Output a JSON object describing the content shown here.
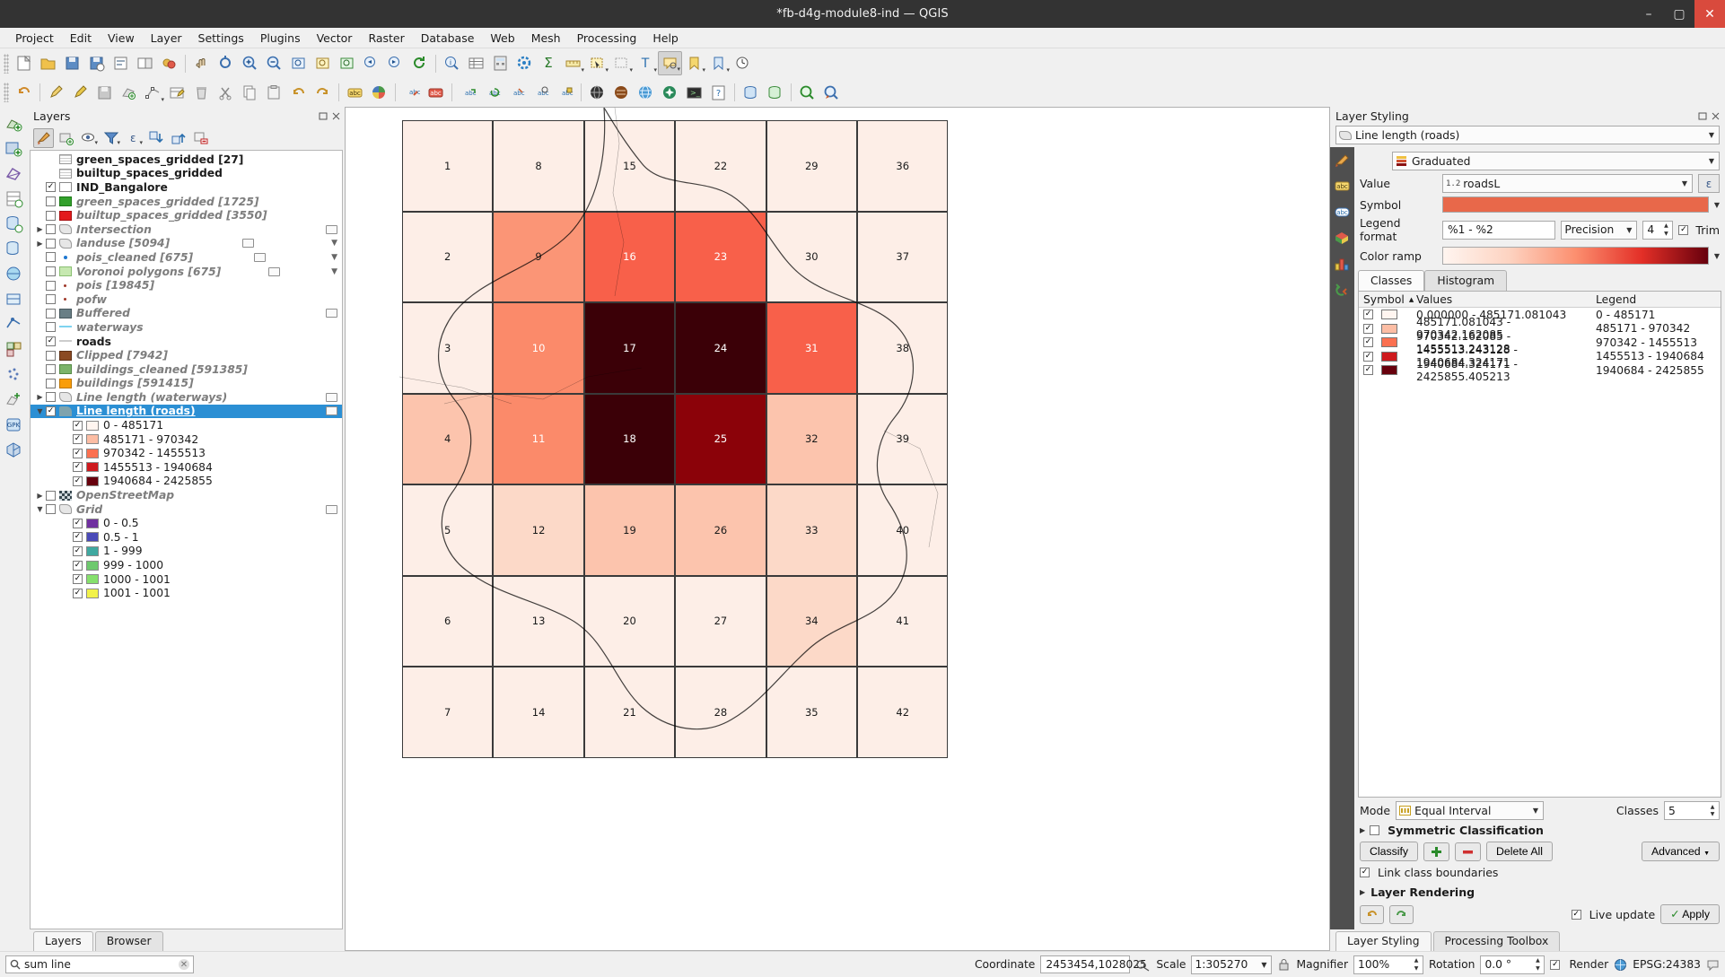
{
  "window": {
    "title": "*fb-d4g-module8-ind — QGIS",
    "minimize": "–",
    "maximize": "▢",
    "close": "✕"
  },
  "menubar": [
    "Project",
    "Edit",
    "View",
    "Layer",
    "Settings",
    "Plugins",
    "Vector",
    "Raster",
    "Database",
    "Web",
    "Mesh",
    "Processing",
    "Help"
  ],
  "layers_panel": {
    "title": "Layers",
    "toolbar_icons": [
      "styling-dock-icon",
      "add-group-icon",
      "visibility-icon",
      "filter-legend-icon",
      "expression-filter-icon",
      "expand-all-icon",
      "collapse-all-icon",
      "remove-layer-icon"
    ],
    "items": [
      {
        "name": "green_spaces_gridded [27]",
        "indent": 1,
        "checkbox": "none",
        "style": "bold",
        "icon": "table-icon",
        "expander": false
      },
      {
        "name": "builtup_spaces_gridded",
        "indent": 1,
        "checkbox": "none",
        "style": "bold",
        "icon": "table-icon",
        "expander": false
      },
      {
        "name": "IND_Bangalore",
        "indent": 1,
        "checkbox": "checked",
        "style": "bold",
        "icon": "polygon-white-icon",
        "expander": false
      },
      {
        "name": "green_spaces_gridded [1725]",
        "indent": 1,
        "checkbox": "unchecked",
        "style": "gray",
        "icon": "polygon-green-icon",
        "expander": false
      },
      {
        "name": "builtup_spaces_gridded [3550]",
        "indent": 1,
        "checkbox": "unchecked",
        "style": "gray",
        "icon": "polygon-red-icon",
        "expander": false
      },
      {
        "name": "Intersection",
        "indent": 0,
        "checkbox": "unchecked",
        "style": "gray",
        "icon": "polygon-outline-icon",
        "expander": true
      },
      {
        "name": "landuse [5094]",
        "indent": 0,
        "checkbox": "unchecked",
        "style": "gray",
        "icon": "polygon-outline-icon",
        "expander": true
      },
      {
        "name": "pois_cleaned [675]",
        "indent": 1,
        "checkbox": "unchecked",
        "style": "gray",
        "icon": "point-blue-icon",
        "expander": false
      },
      {
        "name": "Voronoi polygons [675]",
        "indent": 1,
        "checkbox": "unchecked",
        "style": "gray",
        "icon": "polygon-lightgreen-icon",
        "expander": false
      },
      {
        "name": "pois [19845]",
        "indent": 1,
        "checkbox": "unchecked",
        "style": "gray",
        "icon": "point-red-icon",
        "expander": false
      },
      {
        "name": "pofw",
        "indent": 1,
        "checkbox": "unchecked",
        "style": "gray",
        "icon": "point-red-icon",
        "expander": false
      },
      {
        "name": "Buffered",
        "indent": 1,
        "checkbox": "unchecked",
        "style": "gray",
        "icon": "polygon-slate-icon",
        "expander": false
      },
      {
        "name": "waterways",
        "indent": 1,
        "checkbox": "unchecked",
        "style": "gray",
        "icon": "line-blue-icon",
        "expander": false
      },
      {
        "name": "roads",
        "indent": 1,
        "checkbox": "checked",
        "style": "bold",
        "icon": "line-gray-icon",
        "expander": false
      },
      {
        "name": "Clipped [7942]",
        "indent": 1,
        "checkbox": "unchecked",
        "style": "gray",
        "icon": "polygon-brown-icon",
        "expander": false
      },
      {
        "name": "buildings_cleaned [591385]",
        "indent": 1,
        "checkbox": "unchecked",
        "style": "gray",
        "icon": "polygon-green2-icon",
        "expander": false
      },
      {
        "name": "buildings [591415]",
        "indent": 1,
        "checkbox": "unchecked",
        "style": "gray",
        "icon": "polygon-orange-icon",
        "expander": false
      },
      {
        "name": "Line length (waterways)",
        "indent": 0,
        "checkbox": "unchecked",
        "style": "gray",
        "icon": "polygon-outline-icon",
        "expander": true
      },
      {
        "name": "Line length (roads)",
        "indent": 0,
        "checkbox": "checked",
        "style": "selected",
        "icon": "flag-icon",
        "expander": "open",
        "selected": true
      }
    ],
    "roads_classes": [
      {
        "label": "0 - 485171",
        "color": "#fff5f0"
      },
      {
        "label": "485171 - 970342",
        "color": "#fcbda4"
      },
      {
        "label": "970342 - 1455513",
        "color": "#fb7050"
      },
      {
        "label": "1455513 - 1940684",
        "color": "#ce1a1e"
      },
      {
        "label": "1940684 - 2425855",
        "color": "#67000d"
      }
    ],
    "openstreetmap": {
      "name": "OpenStreetMap"
    },
    "grid": {
      "name": "Grid"
    },
    "grid_classes": [
      {
        "label": "0 - 0.5",
        "color": "#7030a0"
      },
      {
        "label": "0.5 - 1",
        "color": "#4a4ab8"
      },
      {
        "label": "1 - 999",
        "color": "#3fa8a0"
      },
      {
        "label": "999 - 1000",
        "color": "#6ec96e"
      },
      {
        "label": "1000 - 1001",
        "color": "#86e06c"
      },
      {
        "label": "1001 - 1001",
        "color": "#f2f24a"
      }
    ],
    "tabs": [
      {
        "label": "Layers",
        "active": true
      },
      {
        "label": "Browser",
        "active": false
      }
    ]
  },
  "styling_panel": {
    "title": "Layer Styling",
    "layer_selector": "Line length (roads)",
    "renderer": "Graduated",
    "rows": {
      "value_label": "Value",
      "value_field": "roadsL",
      "value_prefix": "1.2",
      "symbol_label": "Symbol",
      "legend_format_label": "Legend format",
      "legend_format_value": "%1 - %2",
      "precision_label": "Precision",
      "precision_value": "4",
      "trim_label": "Trim",
      "color_ramp_label": "Color ramp"
    },
    "tabs": [
      {
        "label": "Classes",
        "active": true
      },
      {
        "label": "Histogram",
        "active": false
      }
    ],
    "table_headers": {
      "symbol": "Symbol",
      "values": "Values",
      "legend": "Legend"
    },
    "table_rows": [
      {
        "color": "#fff5f0",
        "values": "0.000000 - 485171.081043",
        "legend": "0 - 485171"
      },
      {
        "color": "#fcbda4",
        "values": "485171.081043 - 970342.162085",
        "legend": "485171 - 970342"
      },
      {
        "color": "#fb7050",
        "values": "970342.162085 - 1455513.243128",
        "legend": "970342 - 1455513"
      },
      {
        "color": "#ce1a1e",
        "values": "1455513.243128 - 1940684.324171",
        "legend": "1455513 - 1940684"
      },
      {
        "color": "#67000d",
        "values": "1940684.324171 - 2425855.405213",
        "legend": "1940684 - 2425855"
      }
    ],
    "mode_label": "Mode",
    "mode_value": "Equal Interval",
    "classes_label": "Classes",
    "classes_value": "5",
    "symmetric_label": "Symmetric Classification",
    "classify_label": "Classify",
    "delete_all_label": "Delete All",
    "advanced_label": "Advanced",
    "link_boundaries_label": "Link class boundaries",
    "layer_rendering_label": "Layer Rendering",
    "live_update_label": "Live update",
    "apply_label": "Apply",
    "bottom_tabs": [
      {
        "label": "Layer Styling",
        "active": true
      },
      {
        "label": "Processing Toolbox",
        "active": false
      }
    ]
  },
  "statusbar": {
    "locator_value": "sum line",
    "locator_clear": "✕",
    "coordinate_label": "Coordinate",
    "coordinate_value": "2453454,1028025",
    "scale_label": "Scale",
    "scale_value": "1:305270",
    "magnifier_label": "Magnifier",
    "magnifier_value": "100%",
    "rotation_label": "Rotation",
    "rotation_value": "0.0 °",
    "render_label": "Render",
    "crs_label": "EPSG:24383"
  },
  "map": {
    "cells": [
      {
        "n": "1",
        "col": 0,
        "row": 0,
        "fill": "#fdeee7",
        "dark": false
      },
      {
        "n": "8",
        "col": 1,
        "row": 0,
        "fill": "#fdeee7",
        "dark": false
      },
      {
        "n": "15",
        "col": 2,
        "row": 0,
        "fill": "#fdeee7",
        "dark": false
      },
      {
        "n": "22",
        "col": 3,
        "row": 0,
        "fill": "#fdeee7",
        "dark": false
      },
      {
        "n": "29",
        "col": 4,
        "row": 0,
        "fill": "#fdeee7",
        "dark": false
      },
      {
        "n": "36",
        "col": 5,
        "row": 0,
        "fill": "#fdeee7",
        "dark": false
      },
      {
        "n": "2",
        "col": 0,
        "row": 1,
        "fill": "#fdeee7",
        "dark": false
      },
      {
        "n": "9",
        "col": 1,
        "row": 1,
        "fill": "#fb9576",
        "dark": false
      },
      {
        "n": "16",
        "col": 2,
        "row": 1,
        "fill": "#f8604a",
        "dark": true
      },
      {
        "n": "23",
        "col": 3,
        "row": 1,
        "fill": "#f8604a",
        "dark": true
      },
      {
        "n": "30",
        "col": 4,
        "row": 1,
        "fill": "#fdeee7",
        "dark": false
      },
      {
        "n": "37",
        "col": 5,
        "row": 1,
        "fill": "#fdeee7",
        "dark": false
      },
      {
        "n": "3",
        "col": 0,
        "row": 2,
        "fill": "#fdeee7",
        "dark": false
      },
      {
        "n": "10",
        "col": 1,
        "row": 2,
        "fill": "#fb8a6a",
        "dark": true
      },
      {
        "n": "17",
        "col": 2,
        "row": 2,
        "fill": "#3b0007",
        "dark": true
      },
      {
        "n": "24",
        "col": 3,
        "row": 2,
        "fill": "#3b0007",
        "dark": true
      },
      {
        "n": "31",
        "col": 4,
        "row": 2,
        "fill": "#f8604a",
        "dark": true
      },
      {
        "n": "38",
        "col": 5,
        "row": 2,
        "fill": "#fdeee7",
        "dark": false
      },
      {
        "n": "4",
        "col": 0,
        "row": 3,
        "fill": "#fcc4ad",
        "dark": false
      },
      {
        "n": "11",
        "col": 1,
        "row": 3,
        "fill": "#fb8a6a",
        "dark": true
      },
      {
        "n": "18",
        "col": 2,
        "row": 3,
        "fill": "#3b0007",
        "dark": true
      },
      {
        "n": "25",
        "col": 3,
        "row": 3,
        "fill": "#8b0209",
        "dark": true
      },
      {
        "n": "32",
        "col": 4,
        "row": 3,
        "fill": "#fcc4ad",
        "dark": false
      },
      {
        "n": "39",
        "col": 5,
        "row": 3,
        "fill": "#fdeee7",
        "dark": false
      },
      {
        "n": "5",
        "col": 0,
        "row": 4,
        "fill": "#fdeee7",
        "dark": false
      },
      {
        "n": "12",
        "col": 1,
        "row": 4,
        "fill": "#fcd9c8",
        "dark": false
      },
      {
        "n": "19",
        "col": 2,
        "row": 4,
        "fill": "#fcc4ad",
        "dark": false
      },
      {
        "n": "26",
        "col": 3,
        "row": 4,
        "fill": "#fcc4ad",
        "dark": false
      },
      {
        "n": "33",
        "col": 4,
        "row": 4,
        "fill": "#fcd9c8",
        "dark": false
      },
      {
        "n": "40",
        "col": 5,
        "row": 4,
        "fill": "#fdeee7",
        "dark": false
      },
      {
        "n": "6",
        "col": 0,
        "row": 5,
        "fill": "#fdeee7",
        "dark": false
      },
      {
        "n": "13",
        "col": 1,
        "row": 5,
        "fill": "#fdeee7",
        "dark": false
      },
      {
        "n": "20",
        "col": 2,
        "row": 5,
        "fill": "#fdeee7",
        "dark": false
      },
      {
        "n": "27",
        "col": 3,
        "row": 5,
        "fill": "#fdeee7",
        "dark": false
      },
      {
        "n": "34",
        "col": 4,
        "row": 5,
        "fill": "#fcd9c8",
        "dark": false
      },
      {
        "n": "41",
        "col": 5,
        "row": 5,
        "fill": "#fdeee7",
        "dark": false
      },
      {
        "n": "7",
        "col": 0,
        "row": 6,
        "fill": "#fdeee7",
        "dark": false
      },
      {
        "n": "14",
        "col": 1,
        "row": 6,
        "fill": "#fdeee7",
        "dark": false
      },
      {
        "n": "21",
        "col": 2,
        "row": 6,
        "fill": "#fdeee7",
        "dark": false
      },
      {
        "n": "28",
        "col": 3,
        "row": 6,
        "fill": "#fdeee7",
        "dark": false
      },
      {
        "n": "35",
        "col": 4,
        "row": 6,
        "fill": "#fdeee7",
        "dark": false
      },
      {
        "n": "42",
        "col": 5,
        "row": 6,
        "fill": "#fdeee7",
        "dark": false
      }
    ]
  }
}
